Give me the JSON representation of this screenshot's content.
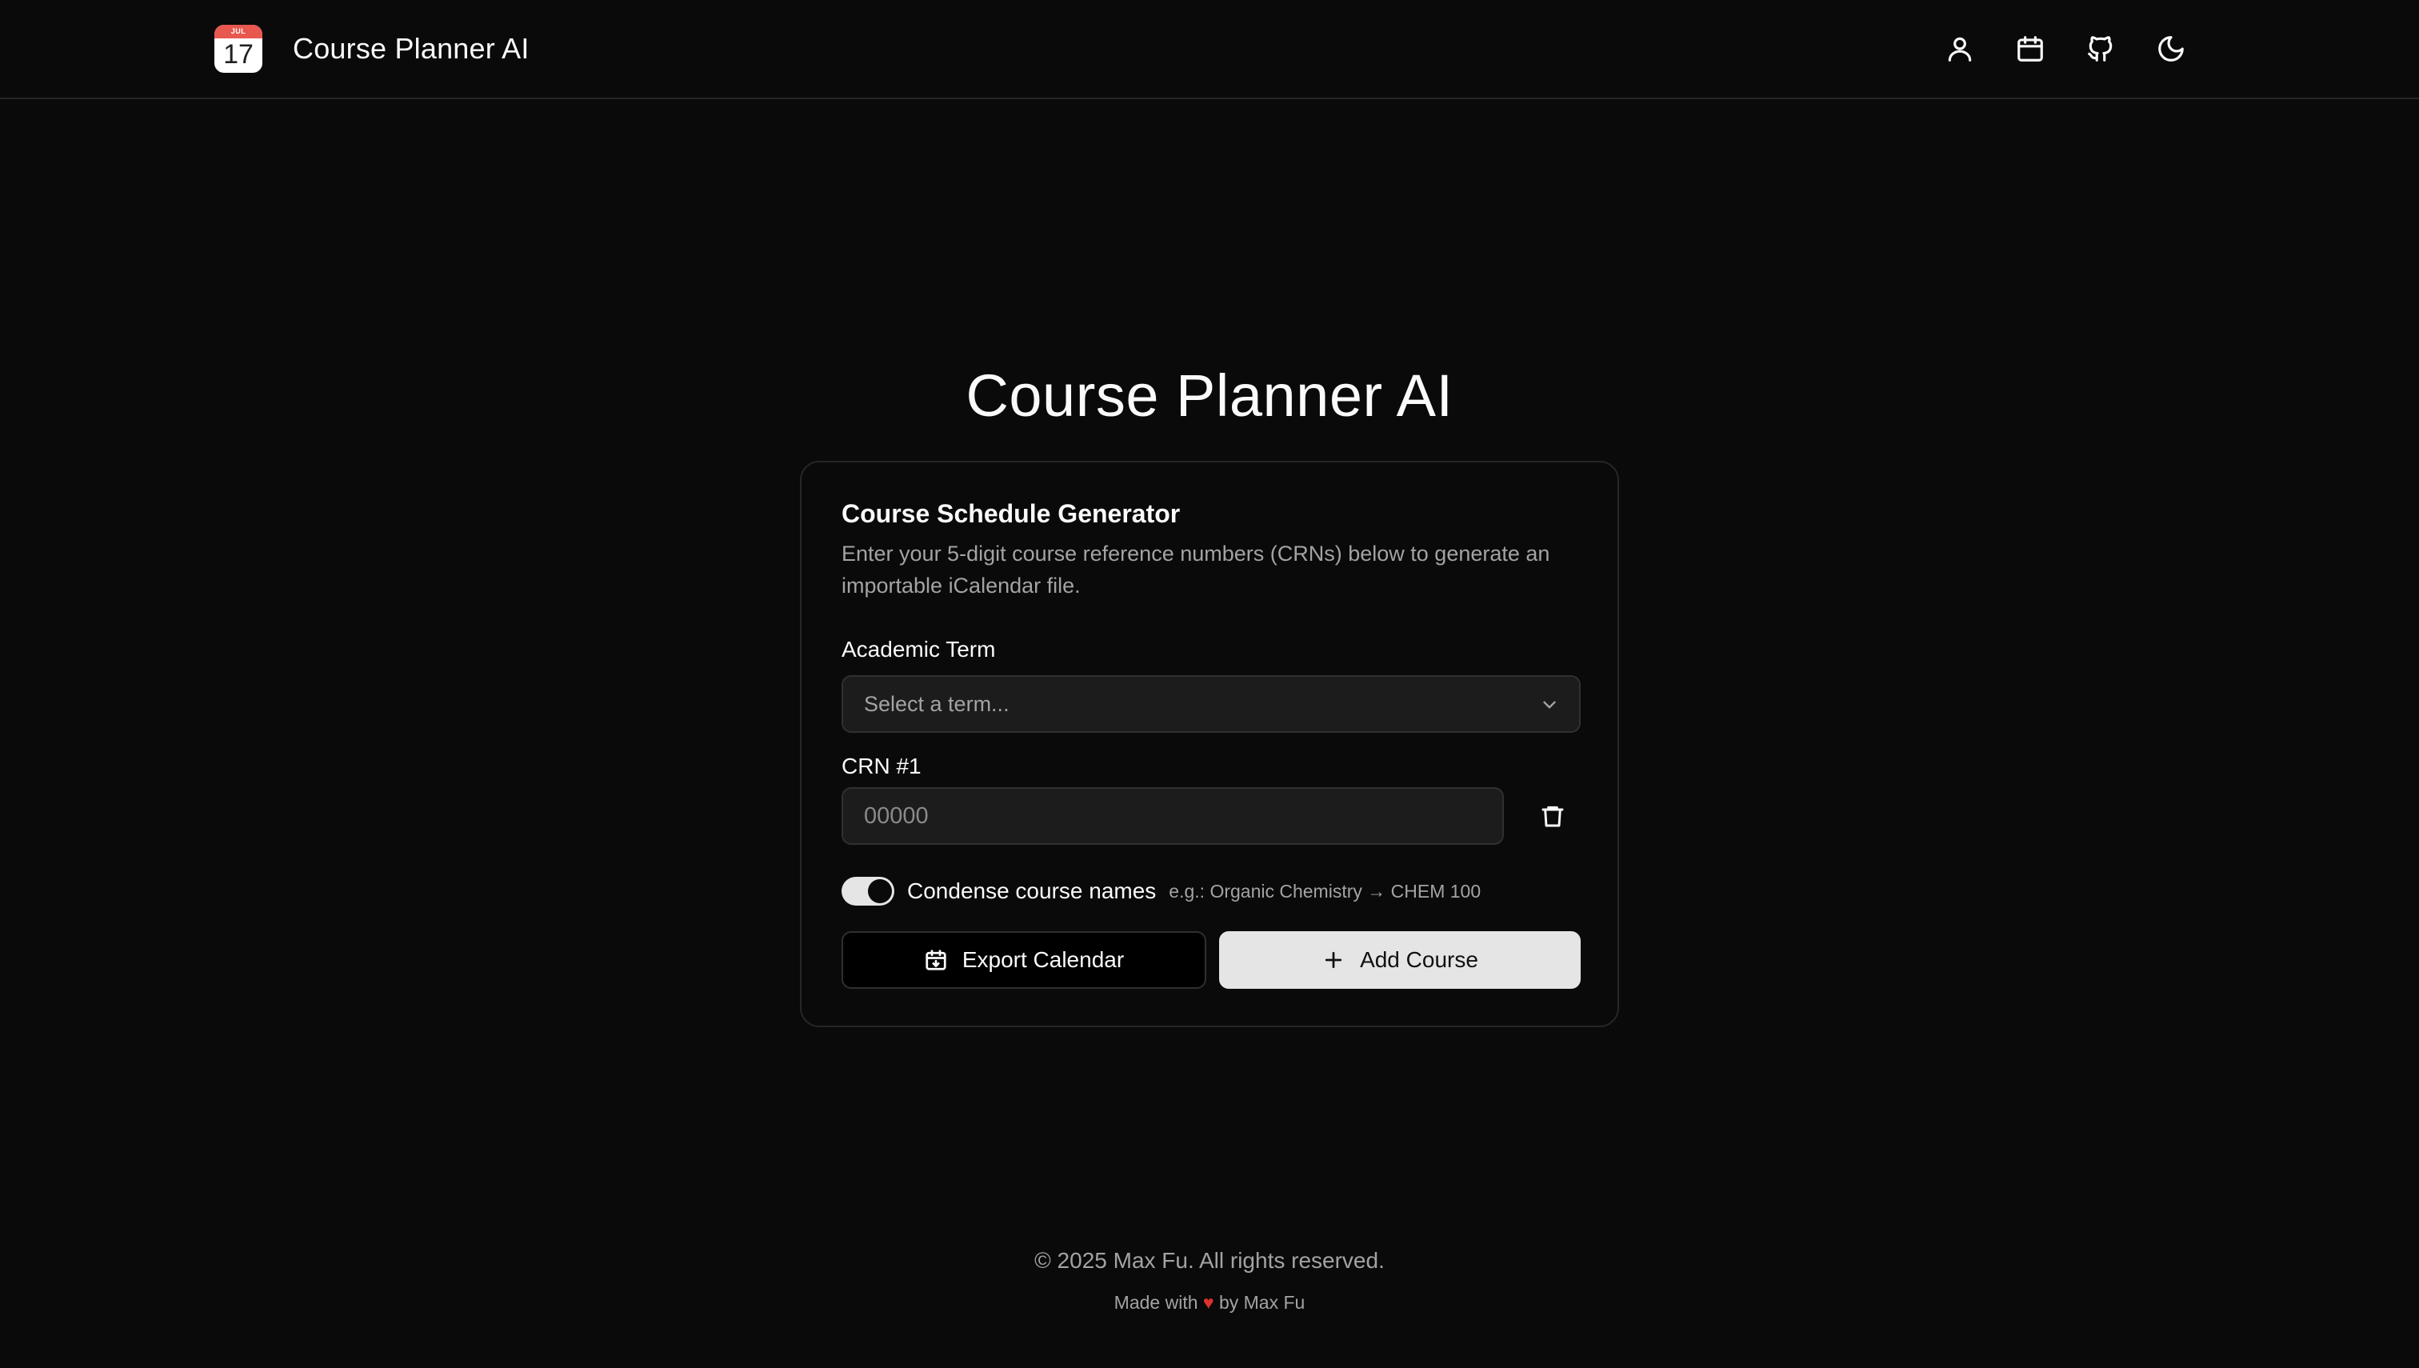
{
  "header": {
    "logo": {
      "month": "JUL",
      "day": "17",
      "icon": "calendar-app-icon"
    },
    "brand_title": "Course Planner AI",
    "actions": [
      {
        "icon": "user-icon"
      },
      {
        "icon": "calendar-icon"
      },
      {
        "icon": "github-icon"
      },
      {
        "icon": "moon-icon"
      }
    ]
  },
  "hero": {
    "title": "Course Planner AI"
  },
  "card": {
    "title": "Course Schedule Generator",
    "description": "Enter your 5-digit course reference numbers (CRNs) below to generate an importable iCalendar file.",
    "term": {
      "label": "Academic Term",
      "placeholder": "Select a term...",
      "value": ""
    },
    "crn": {
      "label": "CRN #1",
      "placeholder": "00000",
      "value": ""
    },
    "condense": {
      "label": "Condense course names",
      "hint": "e.g.: Organic Chemistry → CHEM 100",
      "enabled": true
    },
    "export_label": "Export Calendar",
    "add_label": "Add Course"
  },
  "footer": {
    "copyright": "© 2025 Max Fu. All rights reserved.",
    "made_prefix": "Made with",
    "heart": "♥",
    "made_suffix": "by Max Fu"
  },
  "colors": {
    "background": "#0a0a0a",
    "heart": "#e0322d",
    "logo_accent": "#e8584f",
    "primary_button": "#e5e5e5"
  }
}
